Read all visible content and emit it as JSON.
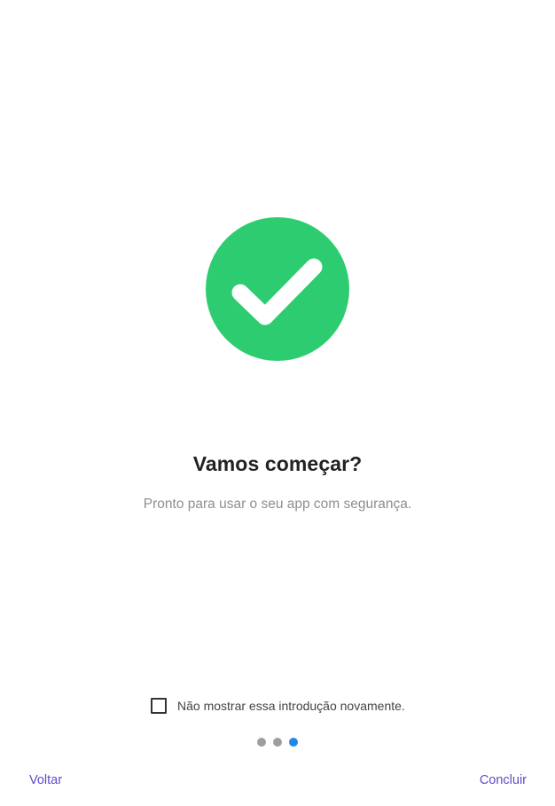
{
  "hero": {
    "icon": "check-circle-icon",
    "color": "#2ecc71"
  },
  "content": {
    "title": "Vamos começar?",
    "subtitle": "Pronto para usar o seu app com segurança."
  },
  "optout": {
    "label": "Não mostrar essa introdução novamente.",
    "checked": false
  },
  "pager": {
    "total": 3,
    "current": 3,
    "active_color": "#1e88e5",
    "inactive_color": "#9e9e9e"
  },
  "nav": {
    "back_label": "Voltar",
    "finish_label": "Concluir",
    "color": "#5c4ccc"
  }
}
